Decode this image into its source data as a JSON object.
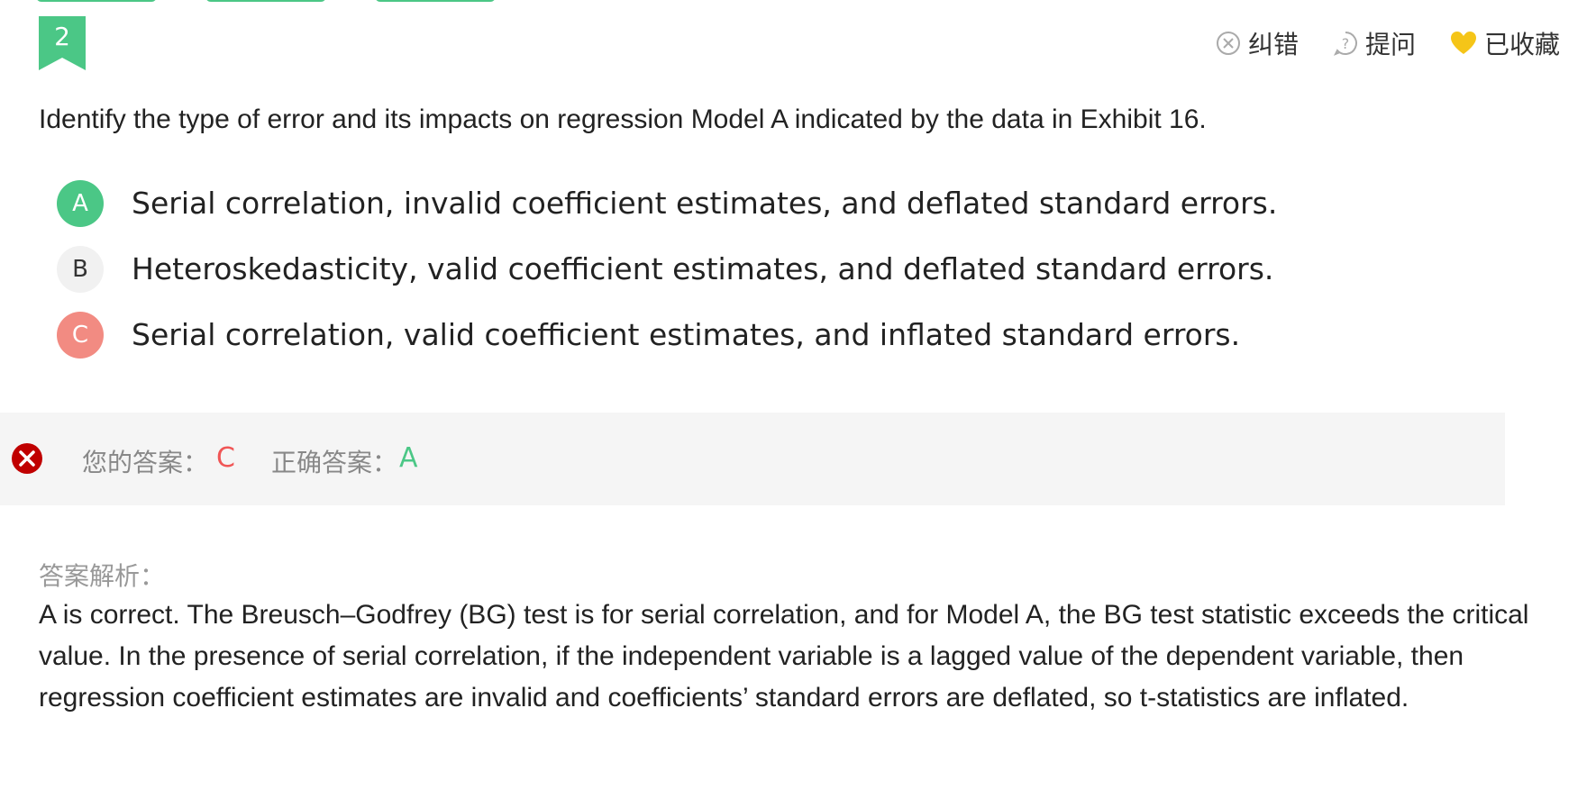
{
  "question_number": "2",
  "toolbar": {
    "report_label": "纠错",
    "ask_label": "提问",
    "favorite_label": "已收藏"
  },
  "question_text": "Identify the type of error and its impacts on regression Model A indicated by the data in Exhibit 16.",
  "options": [
    {
      "letter": "A",
      "text": "Serial correlation, invalid coefficient estimates, and deflated standard errors.",
      "state": "correct"
    },
    {
      "letter": "B",
      "text": "Heteroskedasticity, valid coefficient estimates, and deflated standard errors.",
      "state": "neutral"
    },
    {
      "letter": "C",
      "text": "Serial correlation, valid coefficient estimates, and inflated standard errors.",
      "state": "wrong"
    }
  ],
  "answer": {
    "your_label": "您的答案：",
    "your_value": "C",
    "correct_label": "正确答案：",
    "correct_value": "A"
  },
  "explanation": {
    "label": "答案解析：",
    "text": "A is correct. The Breusch–Godfrey (BG) test is for serial correlation, and for Model A, the BG test statistic exceeds the critical value. In the presence of serial correlation, if the independent variable is a lagged value of the dependent variable, then regression coefficient estimates are invalid and coefficients’ standard errors are deflated, so t-statistics are inflated."
  },
  "colors": {
    "green": "#4bc786",
    "red": "#f28b82",
    "wrong_red": "#c00000",
    "gold": "#f5c518",
    "neutral_badge": "#f1f1f1"
  }
}
